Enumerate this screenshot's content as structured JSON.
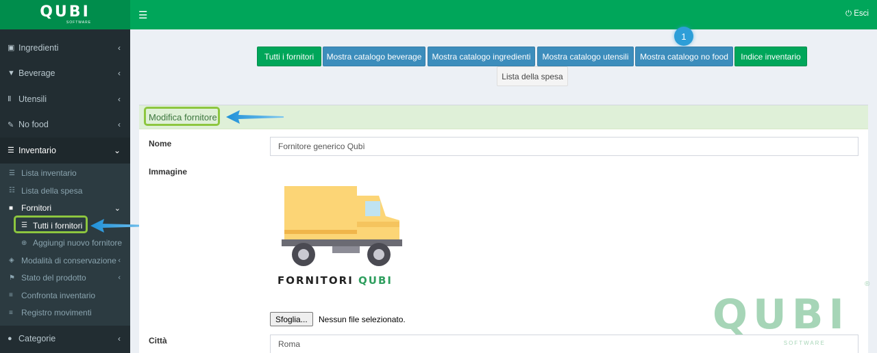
{
  "brand": {
    "logo_text": "QUBI",
    "logo_subtitle": "SOFTWARE"
  },
  "topbar": {
    "logout_label": "Esci"
  },
  "sidebar": {
    "items": [
      {
        "label": "Ingredienti",
        "icon": "sitemap-icon"
      },
      {
        "label": "Beverage",
        "icon": "cocktail-icon"
      },
      {
        "label": "Utensili",
        "icon": "cutlery-icon"
      },
      {
        "label": "No food",
        "icon": "wrench-icon"
      },
      {
        "label": "Inventario",
        "icon": "list-icon"
      },
      {
        "label": "Categorie",
        "icon": "info-circle-icon"
      }
    ],
    "inventario_sub": [
      {
        "label": "Lista inventario"
      },
      {
        "label": "Lista della spesa"
      },
      {
        "label": "Fornitori"
      },
      {
        "label": "Modalità di conservazione"
      },
      {
        "label": "Stato del prodotto"
      },
      {
        "label": "Confronta inventario"
      },
      {
        "label": "Registro movimenti"
      }
    ],
    "fornitori_sub": [
      {
        "label": "Tutti i fornitori"
      },
      {
        "label": "Aggiungi nuovo fornitore"
      }
    ]
  },
  "toolbar": {
    "buttons": [
      {
        "label": "Tutti i fornitori"
      },
      {
        "label": "Mostra catalogo beverage"
      },
      {
        "label": "Mostra catalogo ingredienti"
      },
      {
        "label": "Mostra catalogo utensili"
      },
      {
        "label": "Mostra catalogo no food"
      },
      {
        "label": "Indice inventario"
      },
      {
        "label": "Lista della spesa"
      }
    ],
    "step_badge": "1"
  },
  "form": {
    "title": "Modifica fornitore",
    "name_label": "Nome",
    "name_value": "Fornitore generico Qubì",
    "image_label": "Immagine",
    "image_caption": "FORNITORI",
    "image_caption_brand": "QUBI",
    "file_button": "Sfoglia...",
    "file_status": "Nessun file selezionato.",
    "city_label": "Città",
    "city_value": "Roma"
  },
  "watermark": {
    "text": "QUBI",
    "subtitle": "SOFTWARE",
    "registered": "®"
  },
  "colors": {
    "topbar": "#00a65a",
    "sidebar": "#222d32",
    "primary_blue": "#3c8dbc",
    "success_green": "#00a65a",
    "highlight": "#8dc63f",
    "annotation_arrow": "#2d9ed8"
  }
}
